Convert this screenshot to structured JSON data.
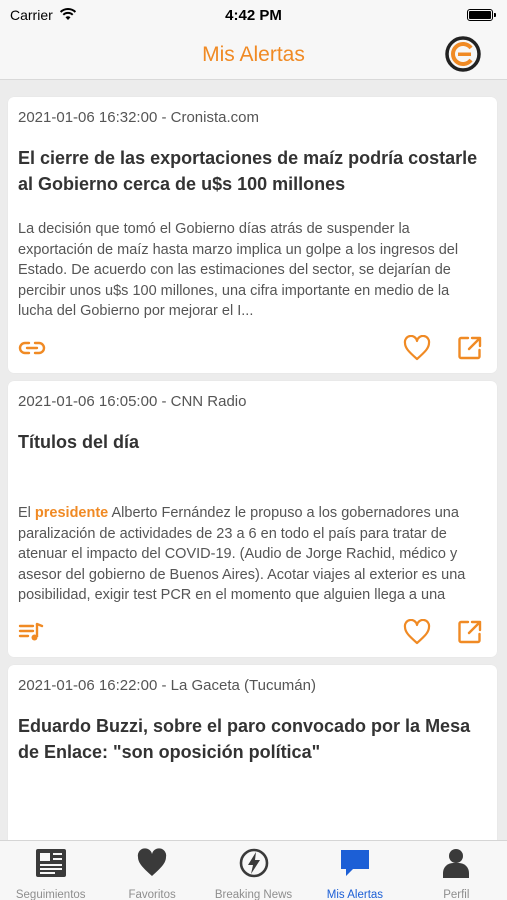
{
  "status_bar": {
    "carrier": "Carrier",
    "time": "4:42 PM"
  },
  "header": {
    "title": "Mis Alertas"
  },
  "accent_color": "#f08a24",
  "cards": [
    {
      "meta": "2021-01-06 16:32:00 - Cronista.com",
      "title": "El cierre de las exportaciones de maíz podría costarle al Gobierno cerca de u$s 100 millones",
      "body_before": "La decisión que tomó el Gobierno días atrás de suspender la exportación de maíz hasta marzo implica un golpe a los ingresos del Estado. De acuerdo con las estimaciones del sector, se dejarían de percibir unos u$s 100 millones, una cifra importante en medio de la lucha del Gobierno por mejorar el I...",
      "highlight": "",
      "body_after": "",
      "type_icon": "link-icon"
    },
    {
      "meta": "2021-01-06 16:05:00 - CNN Radio",
      "title": "Títulos del día",
      "body_before": "El ",
      "highlight": "presidente",
      "body_after": " Alberto Fernández le propuso a los gobernadores una paralización de actividades de 23 a 6 en todo el país para tratar de atenuar el impacto del COVID-19. (Audio de Jorge Rachid, médico y asesor del gobierno de Buenos Aires). Acotar viajes al exterior es una posibilidad, exigir test PCR en el momento que alguien llega a una provincia por vía aérea...",
      "type_icon": "audio-playlist-icon"
    },
    {
      "meta": "2021-01-06 16:22:00 - La Gaceta (Tucumán)",
      "title": "Eduardo Buzzi, sobre el paro convocado por la Mesa de Enlace: \"son oposición política\"",
      "body_before": "",
      "highlight": "",
      "body_after": "",
      "type_icon": ""
    }
  ],
  "tabs": [
    {
      "label": "Seguimientos",
      "icon": "newspaper-icon",
      "active": false
    },
    {
      "label": "Favoritos",
      "icon": "heart-icon",
      "active": false
    },
    {
      "label": "Breaking News",
      "icon": "lightning-icon",
      "active": false
    },
    {
      "label": "Mis Alertas",
      "icon": "chat-bubble-icon",
      "active": true
    },
    {
      "label": "Perfil",
      "icon": "person-icon",
      "active": false
    }
  ]
}
